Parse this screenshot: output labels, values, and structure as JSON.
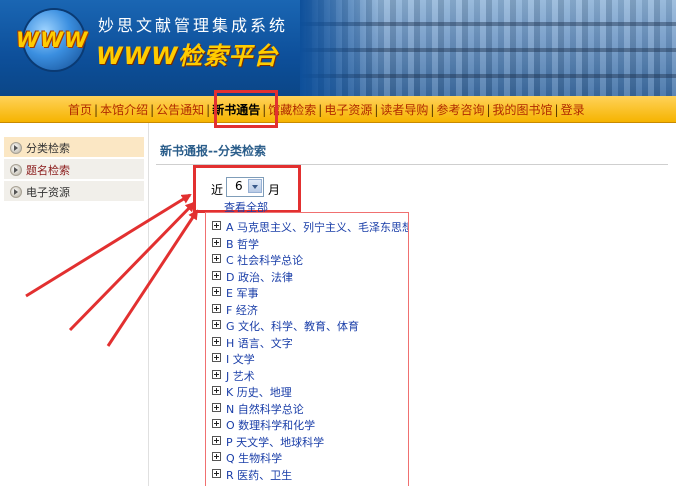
{
  "header": {
    "logo_text": "WWW",
    "system_name": "妙思文献管理集成系统",
    "platform_name": "WWW检索平台"
  },
  "nav": {
    "items": [
      {
        "label": "首页",
        "active": false
      },
      {
        "label": "本馆介绍",
        "active": false
      },
      {
        "label": "公告通知",
        "active": false
      },
      {
        "label": "新书通告",
        "active": true
      },
      {
        "label": "馆藏检索",
        "active": false
      },
      {
        "label": "电子资源",
        "active": false
      },
      {
        "label": "读者导购",
        "active": false
      },
      {
        "label": "参考咨询",
        "active": false
      },
      {
        "label": "我的图书馆",
        "active": false
      },
      {
        "label": "登录",
        "active": false
      }
    ],
    "separator": "|"
  },
  "sidebar": {
    "items": [
      {
        "label": "分类检索",
        "active": true
      },
      {
        "label": "题名检索",
        "active": false
      },
      {
        "label": "电子资源",
        "active": false
      }
    ]
  },
  "main": {
    "title": "新书通报--分类检索",
    "filter": {
      "prefix": "近",
      "selected": "6",
      "suffix": "月"
    },
    "view_all": "查看全部",
    "categories": [
      "A 马克思主义、列宁主义、毛泽东思想",
      "B 哲学",
      "C 社会科学总论",
      "D 政治、法律",
      "E 军事",
      "F 经济",
      "G 文化、科学、教育、体育",
      "H 语言、文字",
      "I 文学",
      "J 艺术",
      "K 历史、地理",
      "N 自然科学总论",
      "O 数理科学和化学",
      "P 天文学、地球科学",
      "Q 生物科学",
      "R 医药、卫生"
    ]
  },
  "colors": {
    "banner_blue": "#0d4f9a",
    "logo_gold": "#ffcc00",
    "nav_bar": "#f6b400",
    "nav_link": "#b02a00",
    "link_blue": "#1a3ea8",
    "title_blue": "#2a5d8a",
    "annotation_red": "#e23030"
  }
}
